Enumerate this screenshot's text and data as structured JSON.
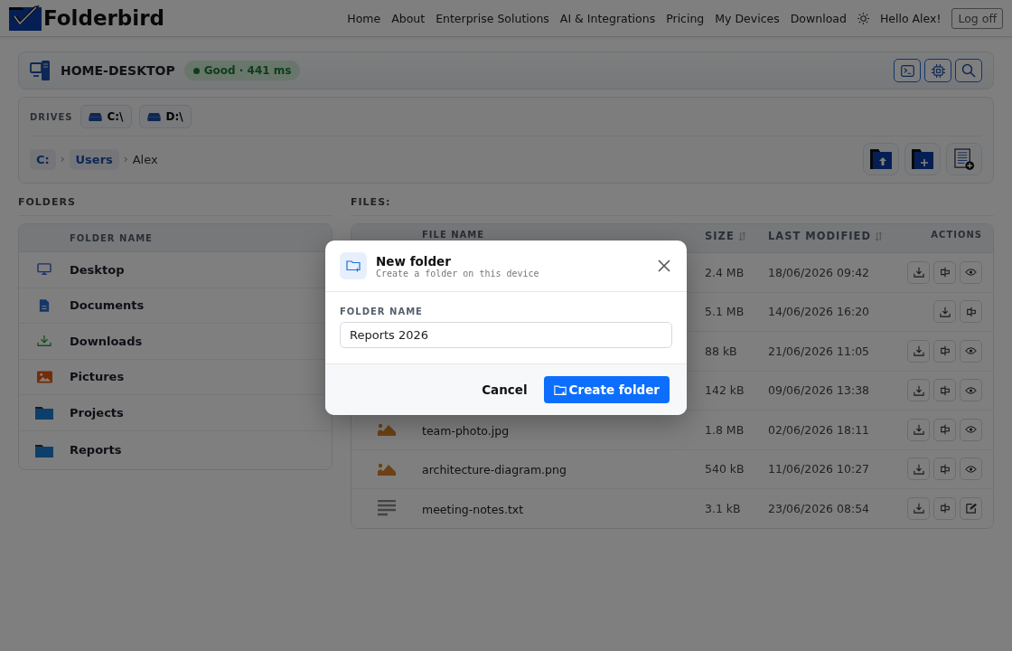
{
  "brand": {
    "name": "Folderbird"
  },
  "nav": {
    "links": [
      "Home",
      "About",
      "Enterprise Solutions",
      "AI & Integrations",
      "Pricing",
      "My Devices",
      "Download"
    ],
    "greeting": "Hello Alex!",
    "logout": "Log off"
  },
  "device": {
    "name": "HOME-DESKTOP",
    "status": "Good · 441 ms",
    "tools": [
      {
        "kind": "terminal"
      },
      {
        "kind": "chip"
      },
      {
        "kind": "search"
      }
    ]
  },
  "drives": {
    "label": "DRIVES",
    "items": [
      {
        "label": "C:\\",
        "selected": false
      },
      {
        "label": "D:\\",
        "selected": false
      }
    ]
  },
  "breadcrumb": [
    {
      "label": "C:",
      "kind": "link"
    },
    {
      "label": "Users",
      "kind": "link",
      "separator": "›"
    },
    {
      "label": "Alex",
      "kind": "current",
      "separator": "›"
    }
  ],
  "path_actions": [
    {
      "kind": "upload"
    },
    {
      "kind": "new-folder"
    },
    {
      "kind": "new-file"
    }
  ],
  "folders": {
    "title": "FOLDERS",
    "column": "FOLDER NAME",
    "items": [
      {
        "name": "Desktop",
        "kind": "monitor"
      },
      {
        "name": "Documents",
        "kind": "document"
      },
      {
        "name": "Downloads",
        "kind": "download"
      },
      {
        "name": "Pictures",
        "kind": "image"
      },
      {
        "name": "Projects",
        "kind": "folder"
      },
      {
        "name": "Reports",
        "kind": "folder"
      }
    ]
  },
  "files": {
    "title": "FILES:",
    "columns": {
      "name": "FILE NAME",
      "size": "SIZE",
      "modified": "LAST MODIFIED",
      "actions": "ACTIONS"
    },
    "rows": [
      {
        "size": "2.4 MB",
        "modified": "18/06/2026 09:42",
        "actions": [
          {
            "kind": "download"
          },
          {
            "kind": "share"
          },
          {
            "kind": "view"
          }
        ]
      },
      {
        "size": "5.1 MB",
        "modified": "14/06/2026 16:20",
        "actions": [
          {
            "kind": "download"
          },
          {
            "kind": "share"
          }
        ]
      },
      {
        "size": "88 kB",
        "modified": "21/06/2026 11:05",
        "actions": [
          {
            "kind": "download"
          },
          {
            "kind": "share"
          },
          {
            "kind": "view"
          }
        ]
      },
      {
        "size": "142 kB",
        "modified": "09/06/2026 13:38",
        "actions": [
          {
            "kind": "download"
          },
          {
            "kind": "share"
          },
          {
            "kind": "view"
          }
        ]
      },
      {
        "name": "team-photo.jpg",
        "kind": "image",
        "size": "1.8 MB",
        "modified": "02/06/2026 18:11",
        "actions": [
          {
            "kind": "download"
          },
          {
            "kind": "share"
          },
          {
            "kind": "view"
          }
        ]
      },
      {
        "name": "architecture-diagram.png",
        "kind": "image",
        "size": "540 kB",
        "modified": "11/06/2026 10:27",
        "actions": [
          {
            "kind": "download"
          },
          {
            "kind": "share"
          },
          {
            "kind": "view"
          }
        ]
      },
      {
        "name": "meeting-notes.txt",
        "kind": "text",
        "size": "3.1 kB",
        "modified": "23/06/2026 08:54",
        "actions": [
          {
            "kind": "download"
          },
          {
            "kind": "share"
          },
          {
            "kind": "edit"
          }
        ]
      }
    ]
  },
  "dialog": {
    "title": "New folder",
    "subtitle": "Create a folder on this device",
    "field_label": "FOLDER NAME",
    "value": "Reports 2026",
    "cancel": "Cancel",
    "confirm": "Create folder"
  }
}
